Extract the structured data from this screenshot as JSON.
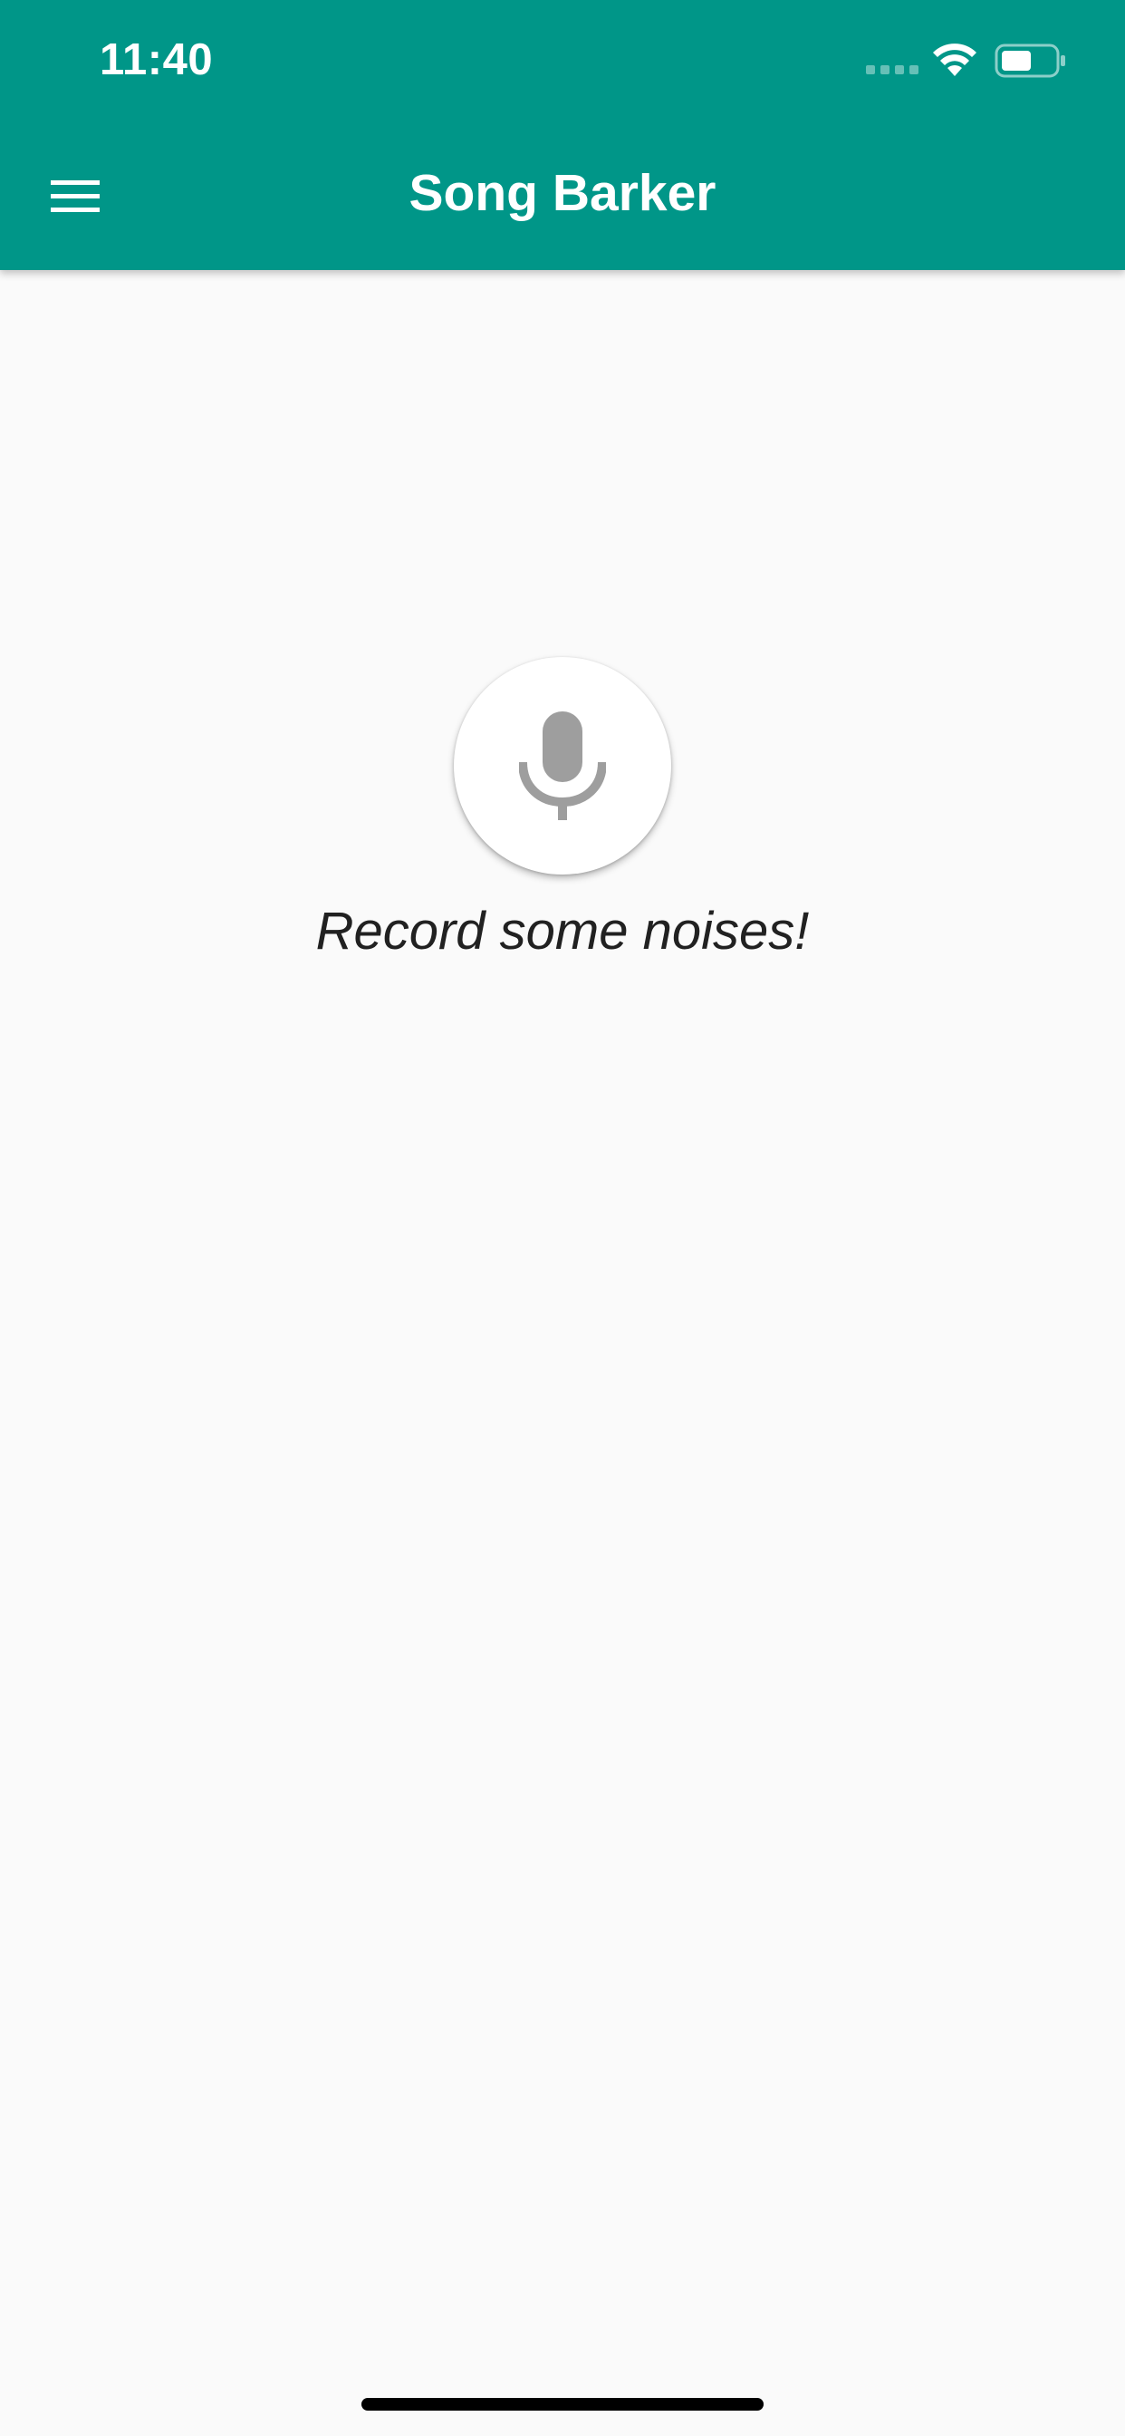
{
  "colors": {
    "primary": "#009688",
    "background": "#fafafa",
    "icon_gray": "#9e9e9e",
    "text_dark": "#212121",
    "on_primary": "#ffffff"
  },
  "status_bar": {
    "time": "11:40",
    "icons": [
      "cellular-signal-icon",
      "wifi-icon",
      "battery-icon"
    ]
  },
  "app_bar": {
    "title": "Song Barker",
    "menu_icon": "hamburger-menu-icon"
  },
  "main": {
    "record_button_icon": "microphone-icon",
    "prompt": "Record some noises!"
  }
}
